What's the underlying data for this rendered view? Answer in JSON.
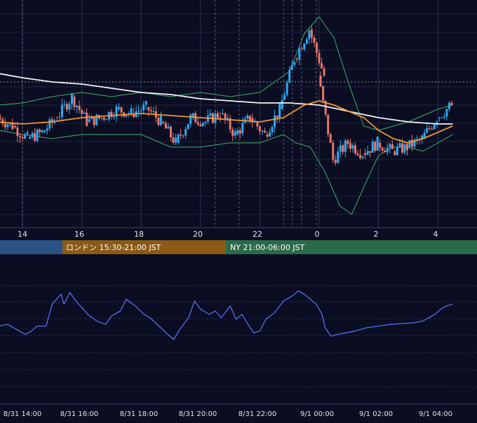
{
  "colors": {
    "background": "#0b0d22",
    "grid": "#1f2340",
    "up_candle": "#2ea8f0",
    "down_candle": "#e8766a",
    "ma_fast": "#f0962e",
    "ma_slow": "#f2f2f2",
    "bollinger": "#3fae6a",
    "oscillator": "#5a6cf0",
    "session_tokyo": "#2b5285",
    "session_london": "#8a5a16",
    "session_ny": "#2a6a48",
    "axis_text": "#e6e6e6"
  },
  "top_axis": {
    "ticks": [
      "14",
      "16",
      "18",
      "20",
      "22",
      "0",
      "2",
      "4"
    ]
  },
  "sessions": {
    "tokyo_label": "",
    "london_label": "ロンドン 15:30-21:00 JST",
    "ny_label": "NY 21:00-06:00 JST"
  },
  "bottom_axis": {
    "ticks": [
      "8/31 14:00",
      "8/31 16:00",
      "8/31 18:00",
      "8/31 20:00",
      "8/31 22:00",
      "9/1 00:00",
      "9/1 02:00",
      "9/1 04:00"
    ]
  },
  "chart_data": [
    {
      "type": "candlestick",
      "x_unit": "hour (JST)",
      "x_range": [
        13.2,
        28.5
      ],
      "ylim": [
        0,
        100
      ],
      "grid": true,
      "ohlc_hourly": [
        {
          "t": 13.5,
          "o": 50,
          "h": 53,
          "l": 44,
          "c": 46
        },
        {
          "t": 14.0,
          "o": 46,
          "h": 48,
          "l": 38,
          "c": 40
        },
        {
          "t": 14.5,
          "o": 40,
          "h": 45,
          "l": 38,
          "c": 43
        },
        {
          "t": 15.0,
          "o": 43,
          "h": 52,
          "l": 42,
          "c": 50
        },
        {
          "t": 15.5,
          "o": 50,
          "h": 62,
          "l": 48,
          "c": 60
        },
        {
          "t": 16.0,
          "o": 60,
          "h": 62,
          "l": 46,
          "c": 48
        },
        {
          "t": 16.5,
          "o": 48,
          "h": 52,
          "l": 44,
          "c": 50
        },
        {
          "t": 17.0,
          "o": 50,
          "h": 58,
          "l": 48,
          "c": 54
        },
        {
          "t": 17.5,
          "o": 54,
          "h": 58,
          "l": 50,
          "c": 52
        },
        {
          "t": 18.0,
          "o": 52,
          "h": 58,
          "l": 50,
          "c": 55
        },
        {
          "t": 18.5,
          "o": 55,
          "h": 57,
          "l": 46,
          "c": 48
        },
        {
          "t": 19.0,
          "o": 48,
          "h": 50,
          "l": 34,
          "c": 38
        },
        {
          "t": 19.5,
          "o": 38,
          "h": 52,
          "l": 36,
          "c": 50
        },
        {
          "t": 20.0,
          "o": 50,
          "h": 56,
          "l": 46,
          "c": 48
        },
        {
          "t": 20.5,
          "o": 48,
          "h": 54,
          "l": 44,
          "c": 52
        },
        {
          "t": 21.0,
          "o": 52,
          "h": 58,
          "l": 30,
          "c": 42
        },
        {
          "t": 21.5,
          "o": 42,
          "h": 54,
          "l": 40,
          "c": 50
        },
        {
          "t": 22.0,
          "o": 50,
          "h": 52,
          "l": 38,
          "c": 42
        },
        {
          "t": 22.5,
          "o": 42,
          "h": 56,
          "l": 40,
          "c": 54
        },
        {
          "t": 23.0,
          "o": 54,
          "h": 82,
          "l": 52,
          "c": 78
        },
        {
          "t": 23.5,
          "o": 78,
          "h": 96,
          "l": 74,
          "c": 92
        },
        {
          "t": 24.0,
          "o": 92,
          "h": 94,
          "l": 66,
          "c": 70
        },
        {
          "t": 24.3,
          "o": 70,
          "h": 72,
          "l": 24,
          "c": 30
        },
        {
          "t": 24.8,
          "o": 30,
          "h": 40,
          "l": 26,
          "c": 38
        },
        {
          "t": 25.3,
          "o": 38,
          "h": 40,
          "l": 30,
          "c": 33
        },
        {
          "t": 25.8,
          "o": 33,
          "h": 40,
          "l": 30,
          "c": 38
        },
        {
          "t": 26.3,
          "o": 38,
          "h": 40,
          "l": 32,
          "c": 34
        },
        {
          "t": 26.8,
          "o": 34,
          "h": 40,
          "l": 32,
          "c": 36
        },
        {
          "t": 27.3,
          "o": 36,
          "h": 42,
          "l": 34,
          "c": 40
        },
        {
          "t": 27.8,
          "o": 40,
          "h": 52,
          "l": 38,
          "c": 50
        },
        {
          "t": 28.3,
          "o": 50,
          "h": 58,
          "l": 48,
          "c": 56
        }
      ],
      "ma_fast": [
        [
          13.2,
          48
        ],
        [
          14,
          47
        ],
        [
          15,
          48
        ],
        [
          16,
          50
        ],
        [
          17,
          51
        ],
        [
          18,
          52
        ],
        [
          19,
          51
        ],
        [
          20,
          50
        ],
        [
          21,
          49
        ],
        [
          22,
          48
        ],
        [
          22.8,
          50
        ],
        [
          23.5,
          56
        ],
        [
          24,
          58
        ],
        [
          24.5,
          56
        ],
        [
          25.5,
          50
        ],
        [
          26,
          44
        ],
        [
          26.5,
          40
        ],
        [
          27,
          38
        ],
        [
          27.5,
          40
        ],
        [
          28,
          43
        ],
        [
          28.5,
          46
        ]
      ],
      "ma_slow": [
        [
          13.2,
          71
        ],
        [
          14,
          69
        ],
        [
          15,
          67
        ],
        [
          16,
          66
        ],
        [
          17,
          64
        ],
        [
          18,
          62
        ],
        [
          19,
          61
        ],
        [
          20,
          59
        ],
        [
          21,
          58
        ],
        [
          22,
          57
        ],
        [
          23,
          57
        ],
        [
          24,
          56
        ],
        [
          25,
          53
        ],
        [
          26,
          50
        ],
        [
          27,
          48
        ],
        [
          28,
          47
        ],
        [
          28.5,
          47
        ]
      ],
      "bb_upper": [
        [
          13.2,
          56
        ],
        [
          14,
          57
        ],
        [
          15,
          60
        ],
        [
          16,
          62
        ],
        [
          17,
          60
        ],
        [
          18,
          62
        ],
        [
          19,
          60
        ],
        [
          20,
          62
        ],
        [
          21,
          60
        ],
        [
          22,
          62
        ],
        [
          23,
          72
        ],
        [
          23.5,
          90
        ],
        [
          24,
          98
        ],
        [
          24.5,
          88
        ],
        [
          25,
          66
        ],
        [
          25.5,
          46
        ],
        [
          26,
          44
        ],
        [
          26.5,
          46
        ],
        [
          27,
          48
        ],
        [
          28,
          54
        ],
        [
          28.5,
          56
        ]
      ],
      "bb_lower": [
        [
          13.2,
          44
        ],
        [
          14,
          42
        ],
        [
          15,
          40
        ],
        [
          16,
          42
        ],
        [
          17,
          42
        ],
        [
          18,
          42
        ],
        [
          19,
          36
        ],
        [
          20,
          36
        ],
        [
          21,
          38
        ],
        [
          22,
          38
        ],
        [
          22.8,
          42
        ],
        [
          23.2,
          38
        ],
        [
          23.7,
          36
        ],
        [
          24.2,
          24
        ],
        [
          24.7,
          8
        ],
        [
          25.1,
          4
        ],
        [
          25.6,
          20
        ],
        [
          26,
          32
        ],
        [
          26.5,
          36
        ],
        [
          27,
          36
        ],
        [
          27.5,
          34
        ],
        [
          28,
          38
        ],
        [
          28.5,
          42
        ]
      ]
    },
    {
      "type": "line",
      "series": [
        {
          "values": [
            [
              13.2,
              52
            ],
            [
              13.5,
              54
            ],
            [
              13.8,
              48
            ],
            [
              14.1,
              42
            ],
            [
              14.3,
              46
            ],
            [
              14.5,
              52
            ],
            [
              14.8,
              52
            ],
            [
              15.0,
              78
            ],
            [
              15.3,
              90
            ],
            [
              15.4,
              78
            ],
            [
              15.6,
              92
            ],
            [
              15.8,
              82
            ],
            [
              16.0,
              74
            ],
            [
              16.2,
              66
            ],
            [
              16.5,
              58
            ],
            [
              16.8,
              54
            ],
            [
              17.0,
              64
            ],
            [
              17.3,
              70
            ],
            [
              17.5,
              84
            ],
            [
              17.8,
              76
            ],
            [
              18.1,
              66
            ],
            [
              18.3,
              62
            ],
            [
              18.6,
              52
            ],
            [
              18.9,
              42
            ],
            [
              19.1,
              36
            ],
            [
              19.3,
              48
            ],
            [
              19.6,
              62
            ],
            [
              19.8,
              82
            ],
            [
              20.0,
              72
            ],
            [
              20.3,
              66
            ],
            [
              20.5,
              70
            ],
            [
              20.7,
              62
            ],
            [
              21.0,
              76
            ],
            [
              21.2,
              60
            ],
            [
              21.4,
              66
            ],
            [
              21.6,
              54
            ],
            [
              21.8,
              44
            ],
            [
              22.0,
              46
            ],
            [
              22.2,
              60
            ],
            [
              22.5,
              68
            ],
            [
              22.8,
              82
            ],
            [
              23.1,
              88
            ],
            [
              23.3,
              94
            ],
            [
              23.5,
              90
            ],
            [
              23.7,
              84
            ],
            [
              23.9,
              78
            ],
            [
              24.1,
              66
            ],
            [
              24.2,
              50
            ],
            [
              24.4,
              40
            ],
            [
              24.6,
              42
            ],
            [
              24.9,
              44
            ],
            [
              25.2,
              46
            ],
            [
              25.6,
              50
            ],
            [
              26.0,
              52
            ],
            [
              26.4,
              54
            ],
            [
              26.8,
              55
            ],
            [
              27.2,
              56
            ],
            [
              27.5,
              58
            ],
            [
              27.7,
              62
            ],
            [
              27.9,
              66
            ],
            [
              28.1,
              72
            ],
            [
              28.3,
              76
            ],
            [
              28.5,
              78
            ]
          ]
        }
      ],
      "ylim": [
        0,
        100
      ],
      "grid": true
    }
  ]
}
